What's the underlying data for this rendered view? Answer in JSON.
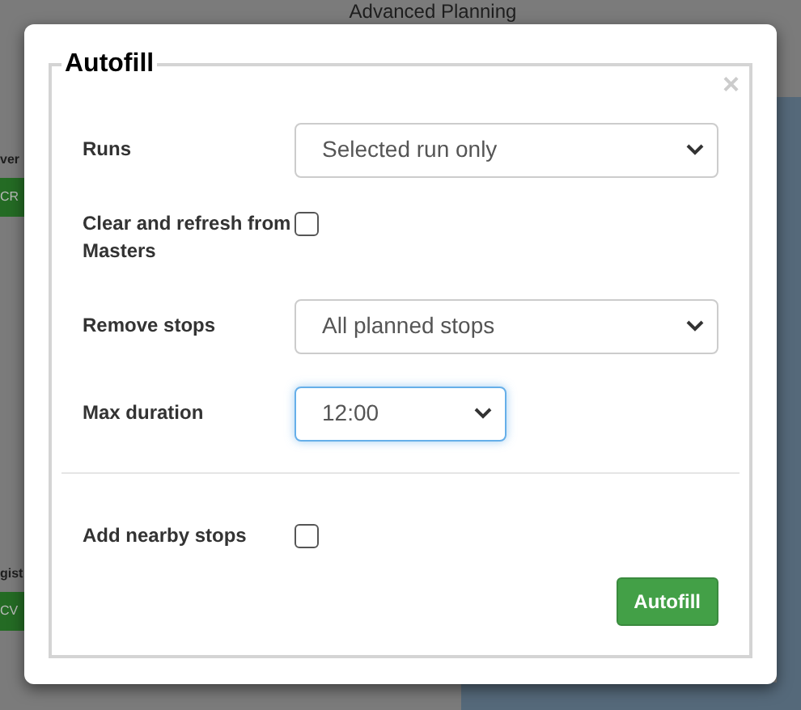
{
  "background": {
    "title": "Advanced Planning",
    "fragments": [
      {
        "kind": "text",
        "text": "ver"
      },
      {
        "kind": "button",
        "text": "CR"
      },
      {
        "kind": "text",
        "text": "gist"
      },
      {
        "kind": "button",
        "text": "CV"
      }
    ]
  },
  "dialog": {
    "legend": "Autofill",
    "close": "×",
    "fields": [
      {
        "kind": "select",
        "label": "Runs",
        "value": "Selected run only",
        "wide": true,
        "focused": false
      },
      {
        "kind": "checkbox",
        "label": "Clear and refresh from Masters",
        "checked": false
      },
      {
        "kind": "select",
        "label": "Remove stops",
        "value": "All planned stops",
        "wide": true,
        "focused": false
      },
      {
        "kind": "select",
        "label": "Max duration",
        "value": "12:00",
        "wide": false,
        "focused": true
      }
    ],
    "extra_fields": [
      {
        "kind": "checkbox",
        "label": "Add nearby stops",
        "checked": false
      }
    ],
    "button": "Autofill"
  }
}
